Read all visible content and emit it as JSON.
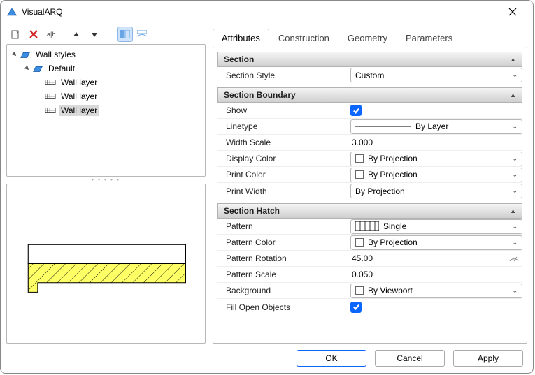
{
  "window": {
    "title": "VisualARQ"
  },
  "toolbar": {
    "new": "new-icon",
    "delete": "delete-icon",
    "rename": "rename-icon",
    "moveup": "move-up-icon",
    "movedown": "move-down-icon",
    "layout_a": "layout-a-icon",
    "layout_b": "layout-b-icon"
  },
  "tree": {
    "root": {
      "label": "Wall styles",
      "expanded": true
    },
    "default": {
      "label": "Default",
      "expanded": true
    },
    "layers": [
      "Wall layer",
      "Wall layer",
      "Wall layer"
    ],
    "selected_index": 2
  },
  "tabs": {
    "items": [
      "Attributes",
      "Construction",
      "Geometry",
      "Parameters"
    ],
    "active_index": 0
  },
  "sections": {
    "section": {
      "title": "Section",
      "section_style": {
        "label": "Section Style",
        "value": "Custom"
      }
    },
    "boundary": {
      "title": "Section Boundary",
      "show": {
        "label": "Show",
        "checked": true
      },
      "linetype": {
        "label": "Linetype",
        "value": "By Layer"
      },
      "width_scale": {
        "label": "Width Scale",
        "value": "3.000"
      },
      "display_color": {
        "label": "Display Color",
        "value": "By Projection"
      },
      "print_color": {
        "label": "Print Color",
        "value": "By Projection"
      },
      "print_width": {
        "label": "Print Width",
        "value": "By Projection"
      }
    },
    "hatch": {
      "title": "Section Hatch",
      "pattern": {
        "label": "Pattern",
        "value": "Single"
      },
      "pattern_color": {
        "label": "Pattern Color",
        "value": "By Projection"
      },
      "pattern_rotation": {
        "label": "Pattern Rotation",
        "value": "45.00"
      },
      "pattern_scale": {
        "label": "Pattern Scale",
        "value": "0.050"
      },
      "background": {
        "label": "Background",
        "value": "By Viewport"
      },
      "fill_open": {
        "label": "Fill Open Objects",
        "checked": true
      }
    }
  },
  "buttons": {
    "ok": "OK",
    "cancel": "Cancel",
    "apply": "Apply"
  }
}
